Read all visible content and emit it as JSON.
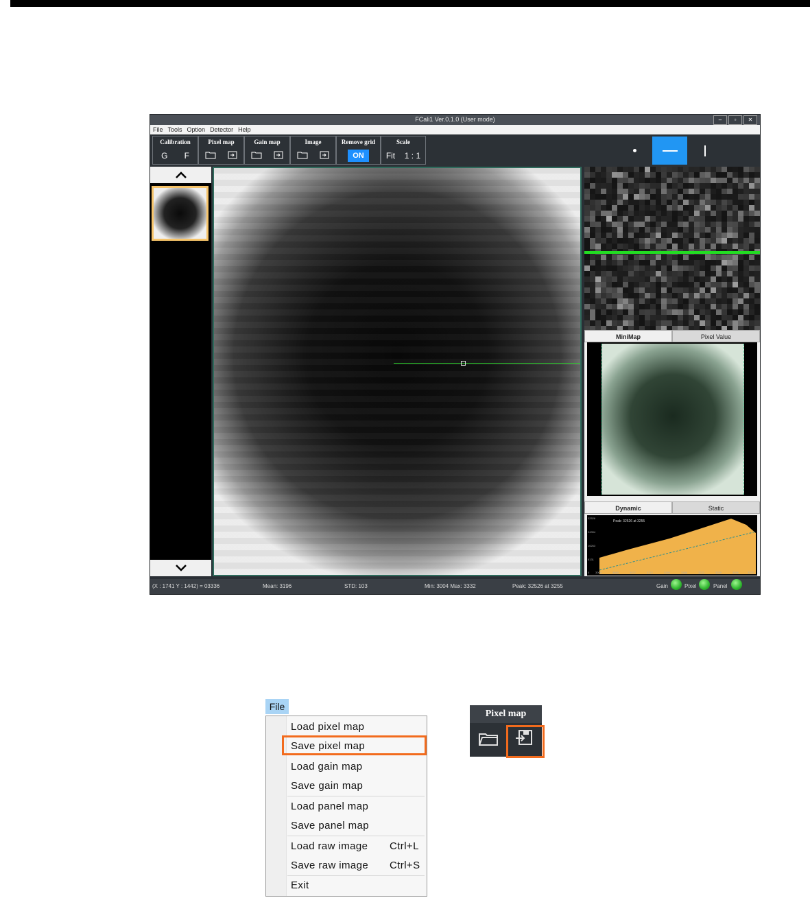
{
  "app": {
    "title": "FCali1 Ver.0.1.0 (User mode)",
    "window_buttons": [
      "‒",
      "▫",
      "✕"
    ],
    "menu": [
      "File",
      "Tools",
      "Option",
      "Detector",
      "Help"
    ],
    "toolbar": {
      "calibration": {
        "title": "Calibration",
        "g": "G",
        "f": "F"
      },
      "pixel_map": {
        "title": "Pixel map"
      },
      "gain_map": {
        "title": "Gain map"
      },
      "image": {
        "title": "Image"
      },
      "remove_grid": {
        "title": "Remove grid",
        "value": "ON"
      },
      "scale": {
        "title": "Scale",
        "fit": "Fit",
        "one_to_one": "1 : 1"
      }
    },
    "view_modes": [
      "dot",
      "horizontal-line",
      "vertical-line"
    ],
    "active_view_mode": "horizontal-line",
    "right_tabs": {
      "minimap": "MiniMap",
      "pixel_value": "Pixel Value"
    },
    "histogram_tabs": {
      "dynamic": "Dynamic",
      "static": "Static"
    },
    "histogram": {
      "annotation": "Peak: 32526 at 3255",
      "y_ticks": [
        "32526",
        "24394",
        "16263",
        "8131",
        "0"
      ],
      "x_ticks": [
        "3004",
        "3040",
        "3077",
        "3113",
        "3150",
        "3186",
        "3222",
        "3259",
        "3296",
        "3332"
      ]
    },
    "status": {
      "coords": "(X : 1741 Y : 1442) = 03336",
      "mean": "Mean: 3196",
      "std": "STD: 103",
      "minmax": "Min: 3004 Max: 3332",
      "peak": "Peak: 32526 at 3255",
      "gain": "Gain",
      "pixel": "Pixel",
      "panel": "Panel"
    },
    "colors": {
      "accent": "#1e90ff",
      "cursor_line": "#2ecc2e",
      "highlight": "#f26b1d",
      "thumb_frame": "#f5c36a"
    }
  },
  "file_menu": {
    "label": "File",
    "items": [
      {
        "label": "Load pixel map",
        "shortcut": ""
      },
      {
        "label": "Save pixel map",
        "shortcut": ""
      },
      {
        "label": "Load gain map",
        "shortcut": ""
      },
      {
        "label": "Save gain map",
        "shortcut": ""
      },
      {
        "label": "Load panel map",
        "shortcut": ""
      },
      {
        "label": "Save panel map",
        "shortcut": ""
      },
      {
        "label": "Load raw image",
        "shortcut": "Ctrl+L"
      },
      {
        "label": "Save raw image",
        "shortcut": "Ctrl+S"
      },
      {
        "label": "Exit",
        "shortcut": ""
      }
    ],
    "highlighted": "Save pixel map"
  },
  "pixel_map_panel": {
    "title": "Pixel map",
    "buttons": [
      "open-folder-icon",
      "save-file-icon"
    ],
    "highlighted": "save-file-icon"
  }
}
